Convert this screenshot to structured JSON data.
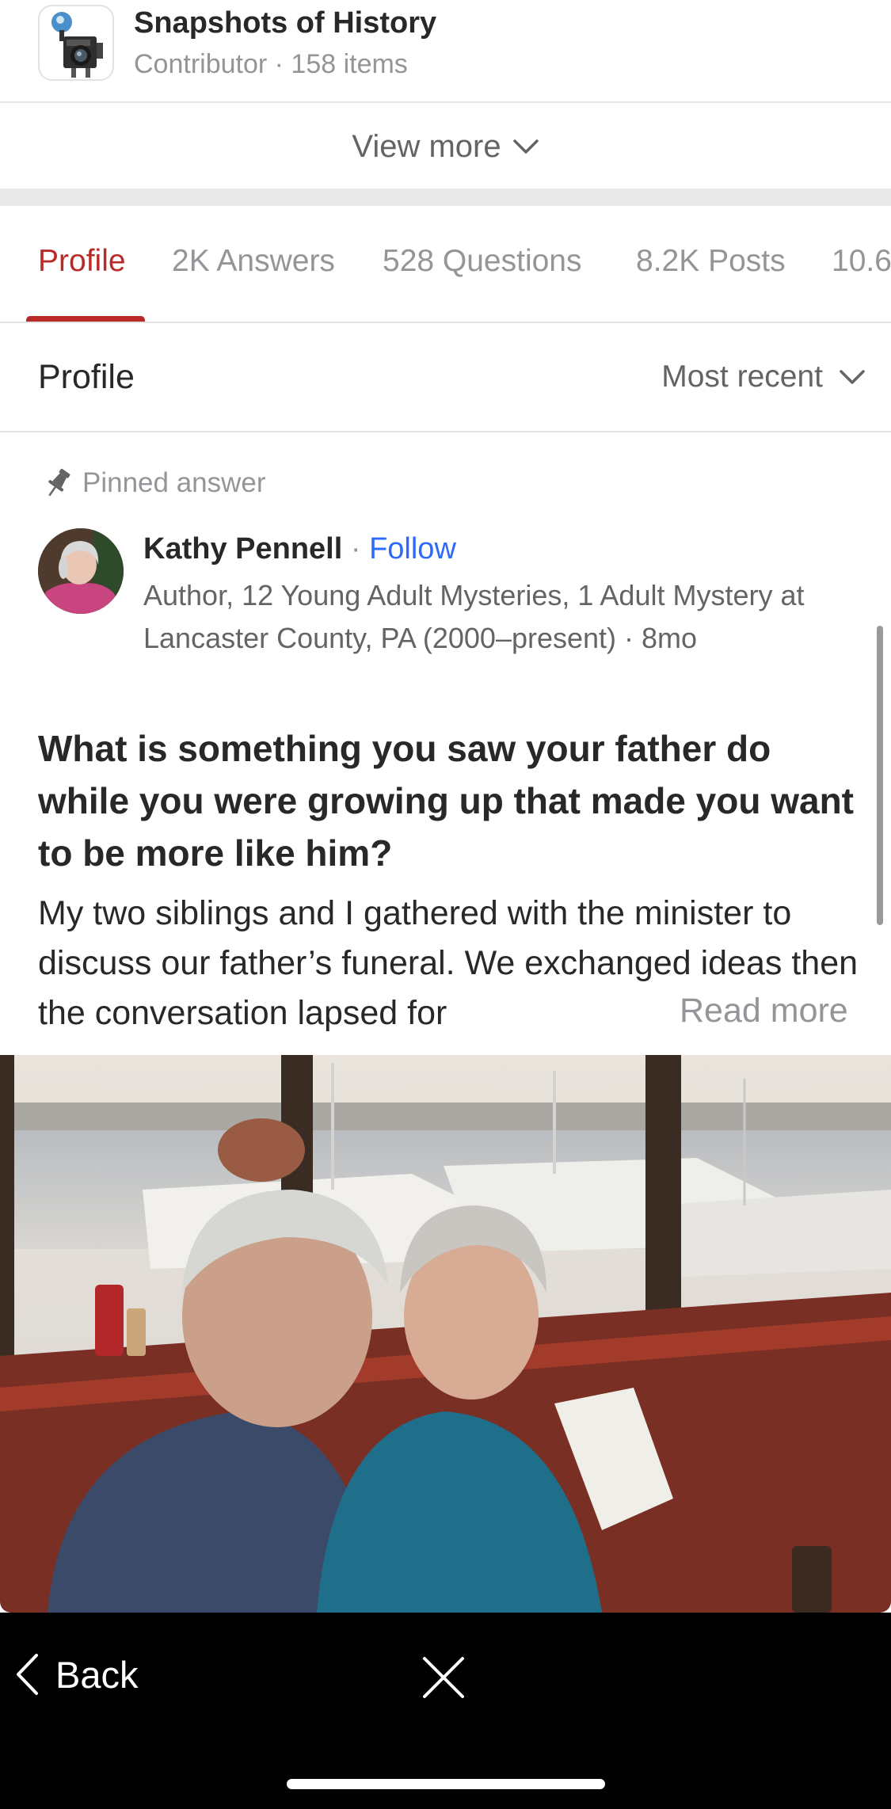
{
  "space": {
    "title": "Snapshots of History",
    "subtitle": "Contributor · 158 items",
    "icon": "vintage-camera-icon"
  },
  "view_more": {
    "label": "View more"
  },
  "tabs": [
    {
      "label": "Profile",
      "active": true
    },
    {
      "label": "2K Answers",
      "active": false
    },
    {
      "label": "528 Questions",
      "active": false
    },
    {
      "label": "8.2K Posts",
      "active": false
    },
    {
      "label": "10.6",
      "active": false
    }
  ],
  "profile_section": {
    "title": "Profile",
    "sort_label": "Most recent"
  },
  "answer": {
    "pinned_label": "Pinned answer",
    "author": {
      "name": "Kathy Pennell",
      "separator": " · ",
      "follow_label": "Follow",
      "credential": "Author, 12 Young Adult Mysteries, 1 Adult Mystery at Lancaster County, PA (2000–present) · 8mo"
    },
    "question": "What is something you saw your father do while you were growing up that made you want to be more like him?",
    "excerpt": "My two siblings and I gathered with the minister to discuss our father’s funeral. We exchanged ideas then the conversation lapsed for",
    "read_more_label": "Read more"
  },
  "bottom_bar": {
    "back_label": "Back"
  },
  "colors": {
    "accent": "#b92b27",
    "link": "#2e69ff",
    "muted": "#939598"
  }
}
